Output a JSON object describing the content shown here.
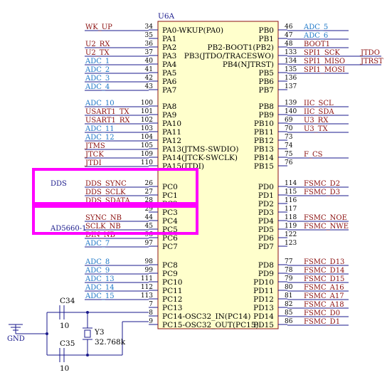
{
  "component": {
    "ref": "U6A"
  },
  "left_pins": [
    {
      "num": "34",
      "name": "PA0-WKUP(PA0)",
      "net": "WK_UP",
      "c": "r"
    },
    {
      "num": "35",
      "name": "PA1",
      "net": "",
      "c": ""
    },
    {
      "num": "36",
      "name": "PA2",
      "net": "U2_RX",
      "c": "r"
    },
    {
      "num": "37",
      "name": "PA3",
      "net": "U2_TX",
      "c": "r"
    },
    {
      "num": "40",
      "name": "PA4",
      "net": "ADC_1",
      "c": "b"
    },
    {
      "num": "41",
      "name": "PA5",
      "net": "ADC_2",
      "c": "b"
    },
    {
      "num": "42",
      "name": "PA6",
      "net": "ADC_3",
      "c": "b"
    },
    {
      "num": "43",
      "name": "PA7",
      "net": "ADC_4",
      "c": "b"
    },
    {
      "num": "100",
      "name": "PA8",
      "net": "ADC_10",
      "c": "b"
    },
    {
      "num": "101",
      "name": "PA9",
      "net": "USART1_TX",
      "c": "r"
    },
    {
      "num": "102",
      "name": "PA10",
      "net": "USART1_RX",
      "c": "r"
    },
    {
      "num": "103",
      "name": "PA11",
      "net": "ADC_11",
      "c": "b"
    },
    {
      "num": "104",
      "name": "PA12",
      "net": "ADC_12",
      "c": "b"
    },
    {
      "num": "105",
      "name": "PA13(JTMS-SWDIO)",
      "net": "JTMS",
      "c": "r"
    },
    {
      "num": "109",
      "name": "PA14(JTCK-SWCLK)",
      "net": "JTCK",
      "c": "r"
    },
    {
      "num": "110",
      "name": "PA15(JTDI)",
      "net": "JTDI",
      "c": "r"
    },
    {
      "num": "26",
      "name": "PC0",
      "net": "DDS_SYNC",
      "c": "r"
    },
    {
      "num": "27",
      "name": "PC1",
      "net": "DDS_SCLK",
      "c": "r"
    },
    {
      "num": "28",
      "name": "PC2",
      "net": "DDS_SDATA",
      "c": "r"
    },
    {
      "num": "29",
      "name": "PC3",
      "net": "",
      "c": ""
    },
    {
      "num": "44",
      "name": "PC4",
      "net": "SYNC_NB",
      "c": "r"
    },
    {
      "num": "45",
      "name": "PC5",
      "net": "SCLK_NB",
      "c": "r"
    },
    {
      "num": "96",
      "name": "PC6",
      "net": "DIN_NB",
      "c": "r"
    },
    {
      "num": "97",
      "name": "PC7",
      "net": "ADC_7",
      "c": "b"
    },
    {
      "num": "98",
      "name": "PC8",
      "net": "ADC_8",
      "c": "b"
    },
    {
      "num": "99",
      "name": "PC9",
      "net": "ADC_9",
      "c": "b"
    },
    {
      "num": "111",
      "name": "PC10",
      "net": "ADC_13",
      "c": "b"
    },
    {
      "num": "112",
      "name": "PC11",
      "net": "ADC_14",
      "c": "b"
    },
    {
      "num": "113",
      "name": "PC12",
      "net": "ADC_15",
      "c": "b"
    },
    {
      "num": "7",
      "name": "PC13",
      "net": "",
      "c": ""
    },
    {
      "num": "8",
      "name": "PC14-OSC32_IN(PC14)",
      "net": "",
      "c": ""
    },
    {
      "num": "9",
      "name": "PC15-OSC32_OUT(PC15)",
      "net": "",
      "c": ""
    }
  ],
  "right_pins": [
    {
      "num": "46",
      "name": "PB0",
      "net": "ADC_5",
      "c": "b",
      "ext": ""
    },
    {
      "num": "47",
      "name": "PB1",
      "net": "ADC_6",
      "c": "b",
      "ext": ""
    },
    {
      "num": "48",
      "name": "PB2-BOOT1(PB2)",
      "net": "BOOT1",
      "c": "r",
      "ext": ""
    },
    {
      "num": "133",
      "name": "PB3(JTDO/TRACESWO)",
      "net": "SPI1_SCK",
      "c": "r",
      "ext": "JTDO"
    },
    {
      "num": "134",
      "name": "PB4(NJTRST)",
      "net": "SPI1_MISO",
      "c": "r",
      "ext": "JTRST"
    },
    {
      "num": "135",
      "name": "PB5",
      "net": "SPI1_MOSI",
      "c": "r",
      "ext": ""
    },
    {
      "num": "136",
      "name": "PB6",
      "net": "",
      "c": "",
      "ext": ""
    },
    {
      "num": "137",
      "name": "PB7",
      "net": "",
      "c": "",
      "ext": ""
    },
    {
      "num": "139",
      "name": "PB8",
      "net": "IIC_SCL",
      "c": "r",
      "ext": ""
    },
    {
      "num": "140",
      "name": "PB9",
      "net": "IIC_SDA",
      "c": "r",
      "ext": ""
    },
    {
      "num": "69",
      "name": "PB10",
      "net": "U3_RX",
      "c": "r",
      "ext": ""
    },
    {
      "num": "70",
      "name": "PB11",
      "net": "U3_TX",
      "c": "r",
      "ext": ""
    },
    {
      "num": "73",
      "name": "PB12",
      "net": "",
      "c": "",
      "ext": ""
    },
    {
      "num": "74",
      "name": "PB13",
      "net": "",
      "c": "",
      "ext": ""
    },
    {
      "num": "75",
      "name": "PB14",
      "net": "F_CS",
      "c": "r",
      "ext": ""
    },
    {
      "num": "76",
      "name": "PB15",
      "net": "",
      "c": "",
      "ext": ""
    },
    {
      "num": "114",
      "name": "PD0",
      "net": "FSMC_D2",
      "c": "r",
      "ext": ""
    },
    {
      "num": "115",
      "name": "PD1",
      "net": "FSMC_D3",
      "c": "r",
      "ext": ""
    },
    {
      "num": "116",
      "name": "PD2",
      "net": "",
      "c": "",
      "ext": ""
    },
    {
      "num": "117",
      "name": "PD3",
      "net": "",
      "c": "",
      "ext": ""
    },
    {
      "num": "118",
      "name": "PD4",
      "net": "FSMC_NOE",
      "c": "r",
      "ext": ""
    },
    {
      "num": "119",
      "name": "PD5",
      "net": "FSMC_NWE",
      "c": "r",
      "ext": ""
    },
    {
      "num": "122",
      "name": "PD6",
      "net": "",
      "c": "",
      "ext": ""
    },
    {
      "num": "123",
      "name": "PD7",
      "net": "",
      "c": "",
      "ext": ""
    },
    {
      "num": "77",
      "name": "PD8",
      "net": "FSMC_D13",
      "c": "r",
      "ext": ""
    },
    {
      "num": "78",
      "name": "PD9",
      "net": "FSMC_D14",
      "c": "r",
      "ext": ""
    },
    {
      "num": "79",
      "name": "PD10",
      "net": "FSMC_D15",
      "c": "r",
      "ext": ""
    },
    {
      "num": "80",
      "name": "PD11",
      "net": "FSMC_A16",
      "c": "r",
      "ext": ""
    },
    {
      "num": "81",
      "name": "PD12",
      "net": "FSMC_A17",
      "c": "r",
      "ext": ""
    },
    {
      "num": "82",
      "name": "PD13",
      "net": "FSMC_A18",
      "c": "r",
      "ext": ""
    },
    {
      "num": "85",
      "name": "PD14",
      "net": "FSMC_D0",
      "c": "r",
      "ext": ""
    },
    {
      "num": "86",
      "name": "PD15",
      "net": "FSMC_D1",
      "c": "r",
      "ext": ""
    }
  ],
  "groups": {
    "dds": "DDS",
    "ad5660": "AD5660-1"
  },
  "passives": {
    "c34": {
      "ref": "C34",
      "value": "10"
    },
    "c35": {
      "ref": "C35",
      "value": "10"
    },
    "y3": {
      "ref": "Y3",
      "value": "32.768k"
    },
    "gnd": "GND"
  },
  "colors": {
    "net_red": "#8b1010",
    "net_blue": "#1e78c8",
    "wire": "#1a1a8c",
    "highlight": "#ff00ff",
    "body": "#ffffcc"
  }
}
